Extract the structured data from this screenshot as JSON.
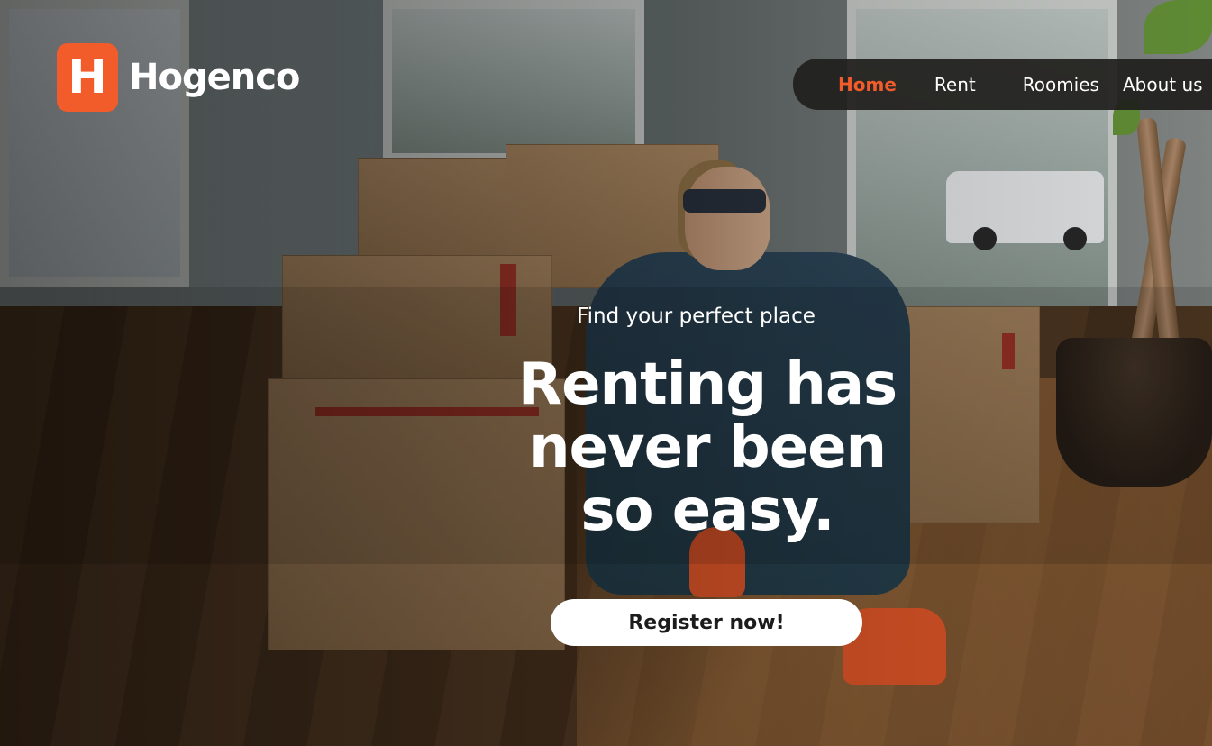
{
  "brand": {
    "logo_letter": "H",
    "name": "Hogenco",
    "accent_color": "#f25c2a"
  },
  "nav": {
    "items": [
      {
        "label": "Home",
        "active": true
      },
      {
        "label": "Rent",
        "active": false
      },
      {
        "label": "Roomies",
        "active": false
      },
      {
        "label": "About us",
        "active": false
      }
    ]
  },
  "hero": {
    "eyebrow": "Find your perfect place",
    "title_line1": "Renting has",
    "title_line2": "never been",
    "title_line3": "so easy.",
    "cta_label": "Register now!"
  }
}
